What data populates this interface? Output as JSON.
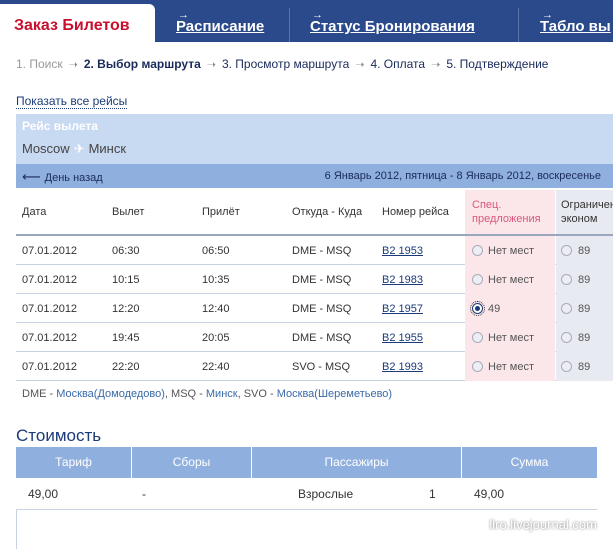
{
  "tabs": {
    "active": "Заказ Билетов",
    "items": [
      "Расписание",
      "Статус Бронирования",
      "Табло вы"
    ]
  },
  "steps": [
    {
      "label": "1. Поиск",
      "state": "done"
    },
    {
      "label": "2. Выбор маршрута",
      "state": "current"
    },
    {
      "label": "3. Просмотр маршрута",
      "state": "next"
    },
    {
      "label": "4. Оплата",
      "state": "next"
    },
    {
      "label": "5. Подтверждение",
      "state": "next"
    }
  ],
  "show_all_link": "Показать все рейсы",
  "flight": {
    "caption": "Рейс вылета",
    "from": "Moscow",
    "to": "Минск",
    "back_label": "День назад",
    "dates": "6 Январь 2012, пятница - 8 Январь 2012, воскресенье"
  },
  "table": {
    "headers": {
      "date": "Дата",
      "dep": "Вылет",
      "arr": "Прилёт",
      "route": "Откуда - Куда",
      "flight": "Номер рейса",
      "spec_1": "Спец.",
      "spec_2": "предложения",
      "econ_1": "Ограничен",
      "econ_2": "эконом"
    },
    "rows": [
      {
        "date": "07.01.2012",
        "dep": "06:30",
        "arr": "06:50",
        "route": "DME - MSQ",
        "flight": "B2 1953",
        "spec": "Нет мест",
        "spec_selected": false,
        "econ": "89"
      },
      {
        "date": "07.01.2012",
        "dep": "10:15",
        "arr": "10:35",
        "route": "DME - MSQ",
        "flight": "B2 1983",
        "spec": "Нет мест",
        "spec_selected": false,
        "econ": "89"
      },
      {
        "date": "07.01.2012",
        "dep": "12:20",
        "arr": "12:40",
        "route": "DME - MSQ",
        "flight": "B2 1957",
        "spec": "49",
        "spec_selected": true,
        "econ": "89"
      },
      {
        "date": "07.01.2012",
        "dep": "19:45",
        "arr": "20:05",
        "route": "DME - MSQ",
        "flight": "B2 1955",
        "spec": "Нет мест",
        "spec_selected": false,
        "econ": "89"
      },
      {
        "date": "07.01.2012",
        "dep": "22:20",
        "arr": "22:40",
        "route": "SVO - MSQ",
        "flight": "B2 1993",
        "spec": "Нет мест",
        "spec_selected": false,
        "econ": "89"
      }
    ]
  },
  "legend": {
    "c1": "DME",
    "n1": "Москва(Домодедово)",
    "c2": "MSQ",
    "n2": "Минск",
    "c3": "SVO",
    "n3": "Москва(Шереметьево)"
  },
  "cost": {
    "title": "Стоимость",
    "headers": {
      "tariff": "Тариф",
      "fees": "Сборы",
      "pax": "Пассажиры",
      "sum": "Сумма"
    },
    "row": {
      "tariff": "49,00",
      "fees": "-",
      "pax": "Взрослые",
      "count": "1",
      "sum": "49,00"
    }
  },
  "watermark": "liro.livejournal.com",
  "colors": {
    "tabbar": "#2a4a8c",
    "brand_red": "#c8102e",
    "panel_light": "#c8d9f2",
    "panel_mid": "#8fb0de",
    "spec_bg": "#fbe7ea"
  }
}
